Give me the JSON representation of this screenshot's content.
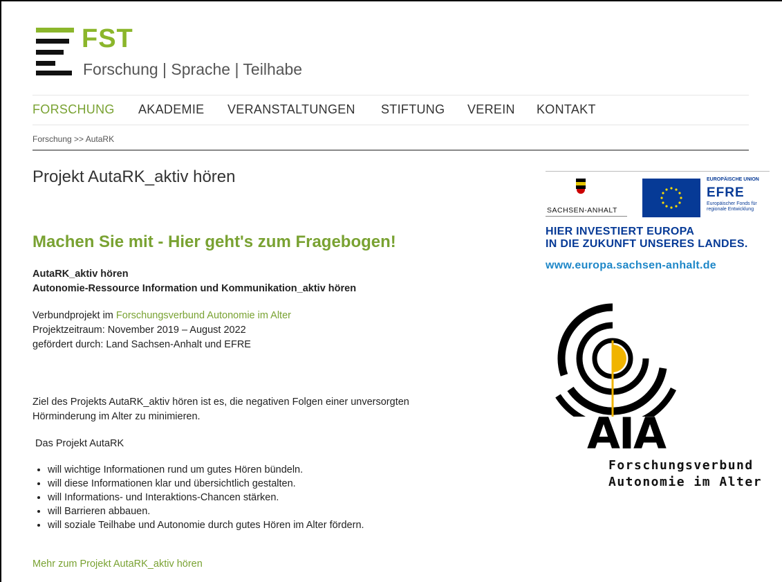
{
  "brand": {
    "name": "FST",
    "tagline": "Forschung | Sprache | Teilhabe",
    "accent": "#8bb62b"
  },
  "nav": {
    "items": [
      {
        "label": "FORSCHUNG",
        "active": true
      },
      {
        "label": "AKADEMIE"
      },
      {
        "label": "VERANSTALTUNGEN"
      },
      {
        "label": "STIFTUNG"
      },
      {
        "label": "VEREIN"
      },
      {
        "label": "KONTAKT"
      }
    ]
  },
  "breadcrumb": "Forschung >> AutaRK",
  "main": {
    "title": "Projekt AutaRK_aktiv hören",
    "cta": "Machen Sie mit - Hier geht's zum Fragebogen!",
    "subtitle_1": "AutaRK_aktiv hören",
    "subtitle_2": "Autonomie-Ressource Information und Kommunikation_aktiv hören",
    "verbund_prefix": "Verbundprojekt im ",
    "verbund_link": "Forschungsverbund Autonomie im Alter",
    "zeitraum": "Projektzeitraum: November 2019 – August 2022",
    "gefoerdert": "gefördert durch: Land Sachsen-Anhalt und EFRE",
    "ziel_1": "Ziel des Projekts AutaRK_aktiv hören ist es, die negativen Folgen einer unversorgten",
    "ziel_2": "Hörminderung im Alter zu minimieren.",
    "das_projekt": " Das Projekt AutaRK",
    "bullets": [
      "will wichtige Informationen rund um gutes Hören bündeln.",
      "will diese Informationen klar und übersichtlich gestalten.",
      "will Informations- und Interaktions-Chancen stärken.",
      "will Barrieren abbauen.",
      "will soziale Teilhabe und Autonomie durch gutes Hören im Alter fördern."
    ],
    "more_link": "Mehr zum Projekt AutaRK_aktiv hören"
  },
  "sidebar": {
    "state_name": "SACHSEN-ANHALT",
    "eu_label": "EUROPÄISCHE UNION",
    "efre": "EFRE",
    "efre_sub_1": "Europäischer Fonds für",
    "efre_sub_2": "regionale Entwicklung",
    "invest_1": "HIER INVESTIERT EUROPA",
    "invest_2": "IN DIE ZUKUNFT UNSERES LANDES.",
    "url": "www.europa.sachsen-anhalt.de",
    "aia_logo_text": "AIA",
    "aia_line_1": "Forschungsverbund",
    "aia_line_2": "Autonomie im Alter"
  }
}
